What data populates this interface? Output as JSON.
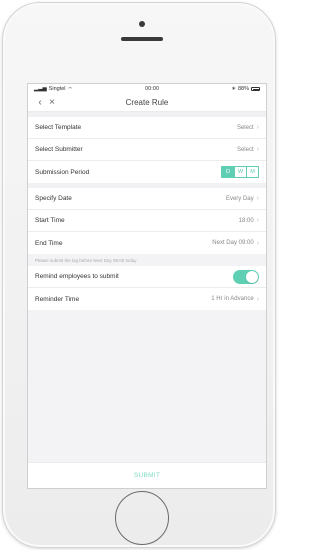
{
  "status_bar": {
    "carrier": "Singtel",
    "time": "00:00",
    "battery": "88%"
  },
  "nav": {
    "title": "Create Rule",
    "back_icon": "chevron-left-icon",
    "close_icon": "close-icon"
  },
  "rows": {
    "template": {
      "label": "Select Template",
      "value": "Select"
    },
    "submitter": {
      "label": "Select Submitter",
      "value": "Select"
    },
    "period": {
      "label": "Submission Period",
      "options": [
        "D",
        "W",
        "M"
      ],
      "selected": "D"
    },
    "specify_date": {
      "label": "Specify Date",
      "value": "Every Day"
    },
    "start_time": {
      "label": "Start Time",
      "value": "18:00"
    },
    "end_time": {
      "label": "End Time",
      "value": "Next Day 09:00"
    }
  },
  "hint": "Please submit the log before Next Day 09:00 today",
  "remind": {
    "label": "Remind employees to submit",
    "on": true
  },
  "reminder_time": {
    "label": "Reminder Time",
    "value": "1 Hr in Advance"
  },
  "submit_label": "SUBMIT",
  "colors": {
    "accent": "#5fcfb3"
  }
}
